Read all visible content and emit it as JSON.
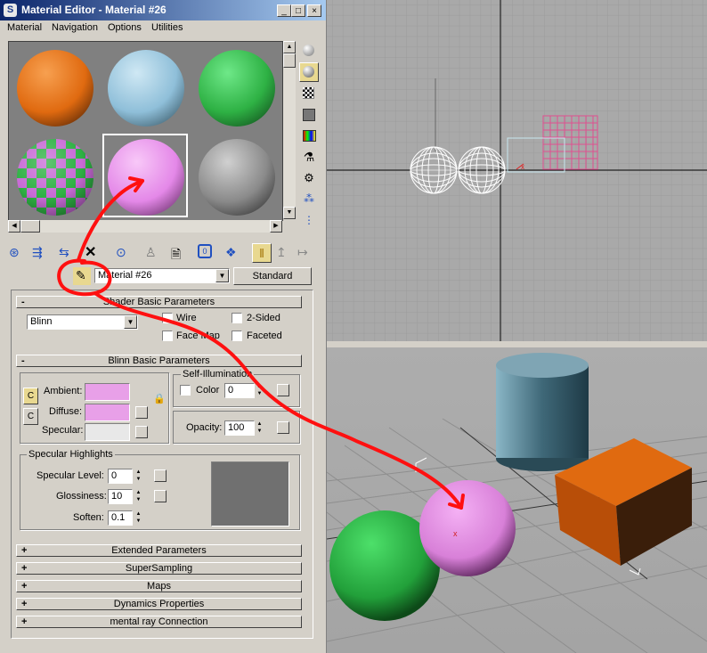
{
  "window": {
    "title": "Material Editor - Material #26"
  },
  "menu": [
    "Material",
    "Navigation",
    "Options",
    "Utilities"
  ],
  "slots": [
    {
      "name": "orange",
      "color": "#e0701c"
    },
    {
      "name": "light-blue",
      "color": "#8fbfd9"
    },
    {
      "name": "green",
      "color": "#2eb144"
    },
    {
      "name": "checker",
      "color": "#c86ad6"
    },
    {
      "name": "pink",
      "color": "#e488e8"
    },
    {
      "name": "gray",
      "color": "#9a9a9a"
    }
  ],
  "material": {
    "name": "Material #26",
    "type": "Standard"
  },
  "shader": {
    "header": "Shader Basic Parameters",
    "shader_type": "Blinn",
    "wire": "Wire",
    "two_sided": "2-Sided",
    "face_map": "Face Map",
    "faceted": "Faceted"
  },
  "blinn": {
    "header": "Blinn Basic Parameters",
    "ambient": "Ambient:",
    "diffuse": "Diffuse:",
    "specular": "Specular:",
    "ambient_color": "#e8a0e8",
    "diffuse_color": "#e8a0e8",
    "specular_color": "#e8e8e8",
    "self_illum_title": "Self-Illumination",
    "color_label": "Color",
    "color_value": "0",
    "opacity_label": "Opacity:",
    "opacity_value": "100"
  },
  "highlights": {
    "title": "Specular Highlights",
    "level_label": "Specular Level:",
    "level_value": "0",
    "gloss_label": "Glossiness:",
    "gloss_value": "10",
    "soften_label": "Soften:",
    "soften_value": "0.1"
  },
  "rollouts": [
    "Extended Parameters",
    "SuperSampling",
    "Maps",
    "Dynamics Properties",
    "mental ray Connection"
  ],
  "colors": {
    "annotation": "#ff0000",
    "title_bar": "#0a246a"
  }
}
